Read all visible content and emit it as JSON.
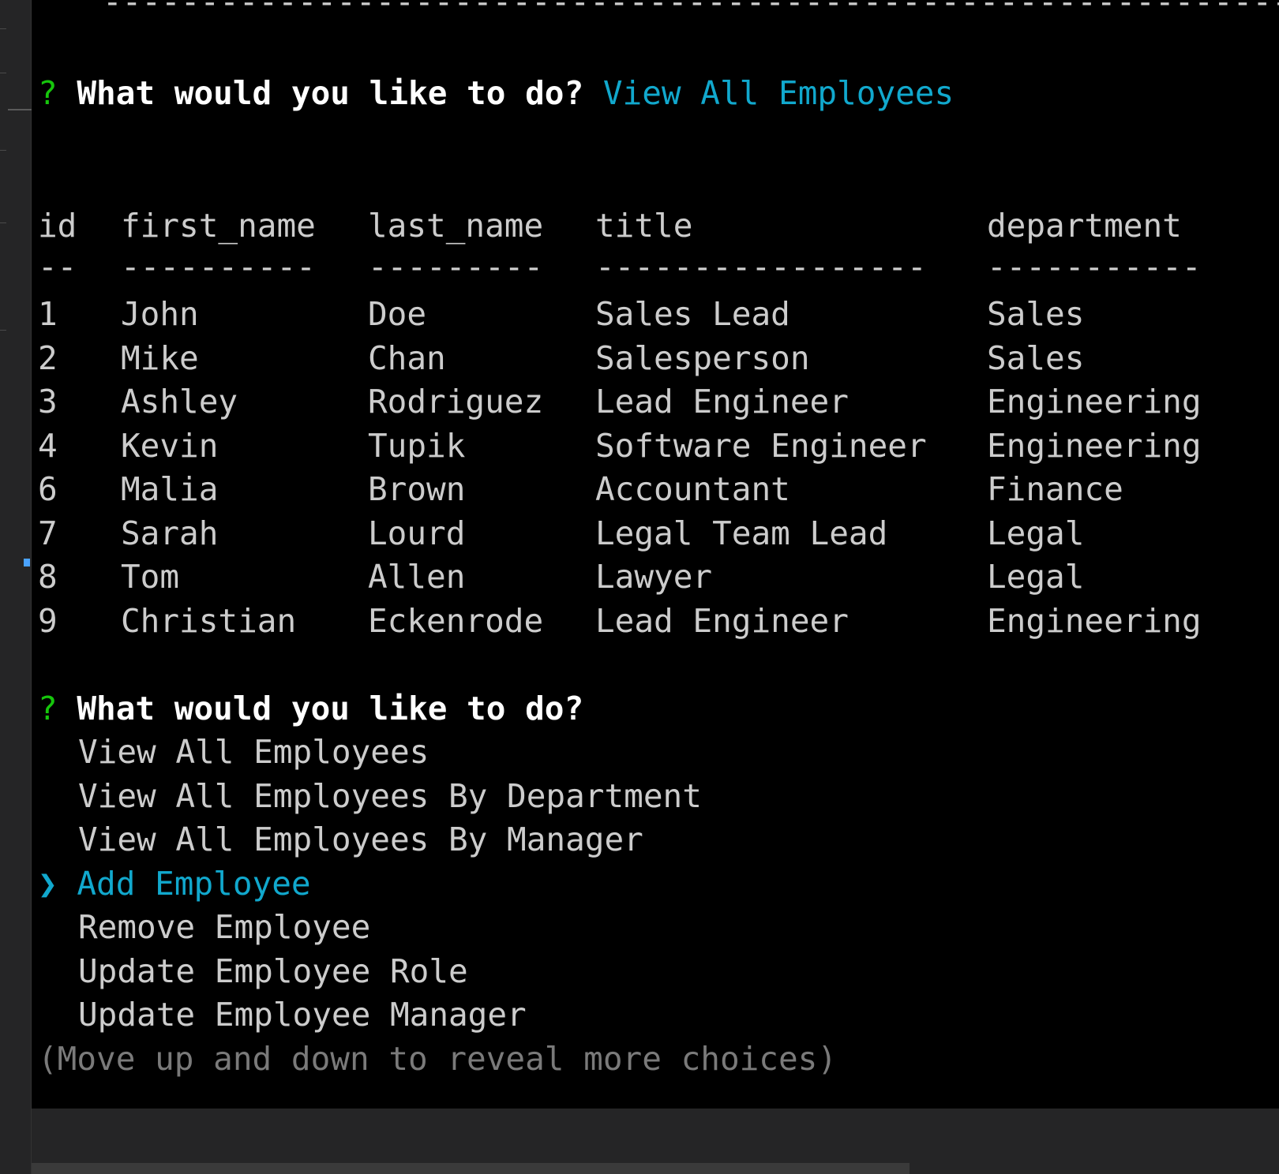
{
  "terminal": {
    "top_rule": "-------------------------------------------------------------",
    "prompt1": {
      "marker": "?",
      "question": "What would you like to do?",
      "answer": "View All Employees"
    },
    "table": {
      "headers": [
        "id",
        "first_name",
        "last_name",
        "title",
        "department"
      ],
      "separators": [
        "--",
        "----------",
        "---------",
        "-----------------",
        "-----------"
      ],
      "rows": [
        [
          "1",
          "John",
          "Doe",
          "Sales Lead",
          "Sales"
        ],
        [
          "2",
          "Mike",
          "Chan",
          "Salesperson",
          "Sales"
        ],
        [
          "3",
          "Ashley",
          "Rodriguez",
          "Lead Engineer",
          "Engineering"
        ],
        [
          "4",
          "Kevin",
          "Tupik",
          "Software Engineer",
          "Engineering"
        ],
        [
          "6",
          "Malia",
          "Brown",
          "Accountant",
          "Finance"
        ],
        [
          "7",
          "Sarah",
          "Lourd",
          "Legal Team Lead",
          "Legal"
        ],
        [
          "8",
          "Tom",
          "Allen",
          "Lawyer",
          "Legal"
        ],
        [
          "9",
          "Christian",
          "Eckenrode",
          "Lead Engineer",
          "Engineering"
        ]
      ]
    },
    "prompt2": {
      "marker": "?",
      "question": "What would you like to do?"
    },
    "menu": {
      "pointer": "❯",
      "items": [
        "View All Employees",
        "View All Employees By Department",
        "View All Employees By Manager",
        "Add Employee",
        "Remove Employee",
        "Update Employee Role",
        "Update Employee Manager"
      ],
      "selected_index": 3,
      "hint": "(Move up and down to reveal more choices)"
    }
  },
  "colors": {
    "background": "#000000",
    "prompt_marker": "#16c60c",
    "accent": "#11a8cd",
    "text": "#cccccc",
    "hint": "#7a7a7a"
  }
}
